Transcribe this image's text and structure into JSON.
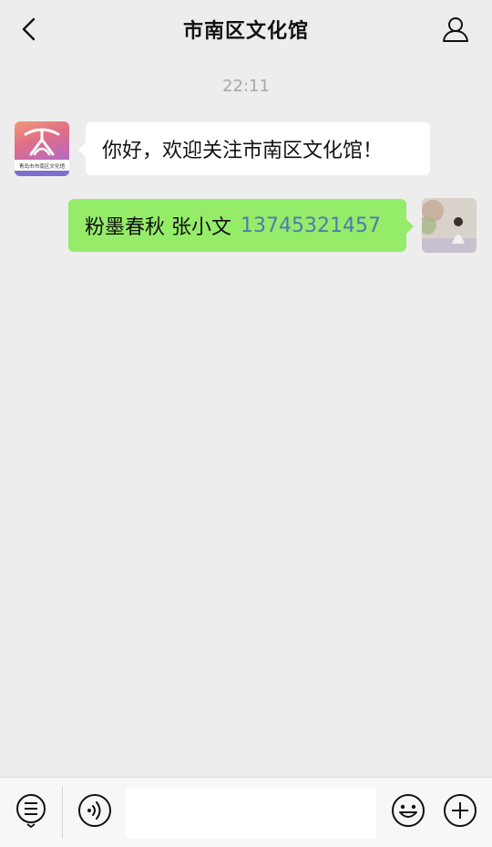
{
  "header": {
    "title": "市南区文化馆"
  },
  "timestamp": "22:11",
  "messages": [
    {
      "direction": "incoming",
      "text": "你好，欢迎关注市南区文化馆！",
      "avatar": {
        "icon": "culture-center-logo-icon",
        "caption": "青岛市市南区文化馆"
      }
    },
    {
      "direction": "outgoing",
      "text": "粉墨春秋 张小文",
      "phone": "13745321457",
      "avatar": {
        "icon": "user-photo-avatar"
      }
    }
  ],
  "input_bar": {
    "text_value": "",
    "icons": [
      "menu-icon",
      "voice-icon",
      "emoji-icon",
      "plus-icon"
    ]
  },
  "colors": {
    "background": "#ededed",
    "outgoing_bubble": "#95ec69",
    "incoming_bubble": "#ffffff",
    "link": "#4a7dae",
    "timestamp": "#a8a8a8"
  }
}
